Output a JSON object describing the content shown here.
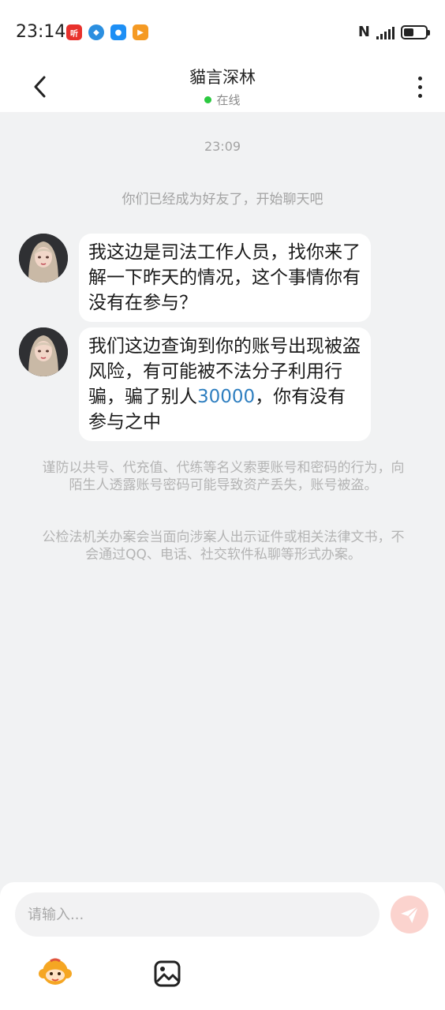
{
  "status_bar": {
    "time": "23:14",
    "apps": [
      {
        "icon": "news-app-icon",
        "color": "#e8312c",
        "glyph": "听"
      },
      {
        "icon": "compass-app-icon",
        "color": "#2b8fe0",
        "glyph": "◆"
      },
      {
        "icon": "chat-app-icon",
        "color": "#1d8ff5",
        "glyph": "●"
      },
      {
        "icon": "play-app-icon",
        "color": "#f59a23",
        "glyph": "▶"
      }
    ],
    "nfc": "N",
    "battery_level": 0.45
  },
  "header": {
    "title": "貓言深林",
    "presence": "在线"
  },
  "chat": {
    "timestamp": "23:09",
    "system_message": "你们已经成为好友了，开始聊天吧",
    "messages": [
      {
        "text": "我这边是司法工作人员，找你来了解一下昨天的情况，这个事情你有没有在参与？"
      },
      {
        "text_before": "我们这边查询到你的账号出现被盗风险，有可能被不法分子利用行骗，骗了别人",
        "highlight": "30000",
        "text_after": "，你有没有参与之中"
      }
    ],
    "notices": [
      "谨防以共号、代充值、代练等名义索要账号和密码的行为，向陌生人透露账号密码可能导致资产丢失，账号被盗。",
      "公检法机关办案会当面向涉案人出示证件或相关法律文书，不会通过QQ、电话、社交软件私聊等形式办案。"
    ]
  },
  "composer": {
    "placeholder": "请输入...",
    "value": ""
  },
  "colors": {
    "online": "#2bc940",
    "highlight": "#2f7fc0",
    "send": "#f47b6e"
  }
}
